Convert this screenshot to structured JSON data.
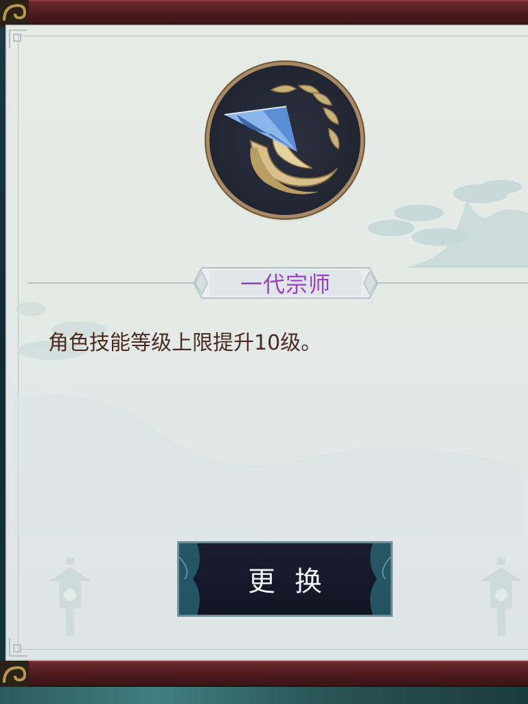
{
  "skill": {
    "title": "一代宗师",
    "description": "角色技能等级上限提升10级。",
    "icon": "straw-hat-wreath-emblem"
  },
  "button": {
    "label": "更换"
  },
  "colors": {
    "title_purple": "#9b3ec5",
    "description_brown": "#4a2a1e",
    "frame_red": "#5a2226",
    "panel_bg": "#e5ebe6",
    "button_dark": "#161a2a"
  }
}
